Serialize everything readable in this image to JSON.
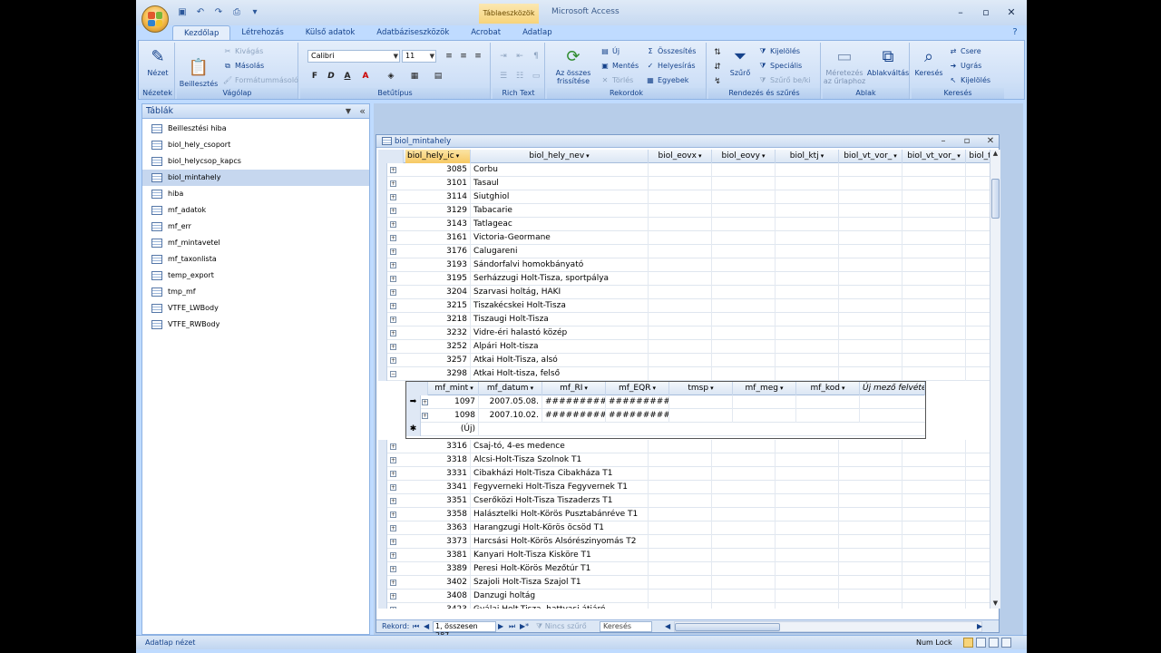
{
  "window": {
    "app_title": "Microsoft Access",
    "context_label": "Táblaeszközök",
    "colors": {
      "ribbon": "#dbe8f8",
      "selection": "#f7c964",
      "frame": "#bfdbff"
    }
  },
  "tabs": [
    "Kezdőlap",
    "Létrehozás",
    "Külső adatok",
    "Adatbáziseszközök",
    "Acrobat",
    "Adatlap"
  ],
  "ribbon": {
    "nezetek": {
      "label": "Nézetek",
      "view_btn": "Nézet"
    },
    "vagolap": {
      "label": "Vágólap",
      "paste": "Beillesztés",
      "cut": "Kivágás",
      "copy": "Másolás",
      "painter": "Formátummásoló"
    },
    "betutipus": {
      "label": "Betűtípus",
      "font": "Calibri",
      "size": "11"
    },
    "richtext": {
      "label": "Rich Text"
    },
    "rekordok": {
      "label": "Rekordok",
      "refresh": "Az összes frissítése",
      "new": "Új",
      "save": "Mentés",
      "delete": "Törlés",
      "totals": "Összesítés",
      "spelling": "Helyesírás",
      "more": "Egyebek"
    },
    "rendezes": {
      "label": "Rendezés és szűrés",
      "filter": "Szűrő",
      "selection": "Kijelölés",
      "advanced": "Speciális",
      "toggle": "Szűrő be/ki"
    },
    "ablak": {
      "label": "Ablak",
      "fit": "Méretezés az űrlaphoz",
      "switch": "Ablakváltás"
    },
    "kereses": {
      "label": "Keresés",
      "find": "Keresés",
      "replace": "Csere",
      "goto": "Ugrás",
      "select": "Kijelölés"
    }
  },
  "nav": {
    "title": "Táblák",
    "items": [
      "Beillesztési hiba",
      "biol_hely_csoport",
      "biol_helycsop_kapcs",
      "biol_mintahely",
      "hiba",
      "mf_adatok",
      "mf_err",
      "mf_mintavetel",
      "mf_taxonlista",
      "temp_export",
      "tmp_mf",
      "VTFE_LWBody",
      "VTFE_RWBody"
    ],
    "selected": "biol_mintahely"
  },
  "table": {
    "title": "biol_mintahely",
    "columns": [
      "biol_hely_ic",
      "biol_hely_nev",
      "biol_eovx",
      "biol_eovy",
      "biol_ktj",
      "biol_vt_vor_",
      "biol_vt_vor_",
      "biol_t"
    ],
    "rows_top": [
      [
        "3085",
        "Corbu"
      ],
      [
        "3101",
        "Tasaul"
      ],
      [
        "3114",
        "Siutghiol"
      ],
      [
        "3129",
        "Tabacarie"
      ],
      [
        "3143",
        "Tatlageac"
      ],
      [
        "3161",
        "Victoria-Geormane"
      ],
      [
        "3176",
        "Calugareni"
      ],
      [
        "3193",
        "Sándorfalvi homokbányató"
      ],
      [
        "3195",
        "Serházzugi Holt-Tisza, sportpálya"
      ],
      [
        "3204",
        "Szarvasi holtág, HAKI"
      ],
      [
        "3215",
        "Tiszakécskei Holt-Tisza"
      ],
      [
        "3218",
        "Tiszaugi Holt-Tisza"
      ],
      [
        "3232",
        "Vidre-éri halastó közép"
      ],
      [
        "3252",
        "Alpári Holt-tisza"
      ],
      [
        "3257",
        "Atkai Holt-Tisza, alsó"
      ],
      [
        "3298",
        "Atkai Holt-tisza, felső"
      ]
    ],
    "rows_bottom": [
      [
        "3316",
        "Csaj-tó, 4-es medence"
      ],
      [
        "3318",
        "Alcsi-Holt-Tisza Szolnok T1"
      ],
      [
        "3331",
        "Cibakházi Holt-Tisza Cibakháza T1"
      ],
      [
        "3341",
        "Fegyverneki Holt-Tisza Fegyvernek T1"
      ],
      [
        "3351",
        "Cserőközi Holt-Tisza Tiszaderzs T1"
      ],
      [
        "3358",
        "Halásztelki Holt-Körös Pusztabánréve T1"
      ],
      [
        "3363",
        "Harangzugi Holt-Körös öcsöd T1"
      ],
      [
        "3373",
        "Harcsási Holt-Körös Alsórészinyomás T2"
      ],
      [
        "3381",
        "Kanyari Holt-Tisza Kisköre T1"
      ],
      [
        "3389",
        "Peresi Holt-Körös Mezőtúr T1"
      ],
      [
        "3402",
        "Szajoli Holt-Tisza Szajol T1"
      ],
      [
        "3408",
        "Danzugi holtág"
      ],
      [
        "3423",
        "Gyálai Holt-Tisza, hattyasi átjáró"
      ]
    ]
  },
  "subtable": {
    "columns": [
      "mf_mint",
      "mf_datum",
      "mf_RI",
      "mf_EQR",
      "tmsp",
      "mf_meg",
      "mf_kod",
      "Új mező felvétele"
    ],
    "rows": [
      [
        "1097",
        "2007.05.08.",
        "##########",
        "##########"
      ],
      [
        "1098",
        "2007.10.02.",
        "##########",
        "##########"
      ]
    ],
    "new_row": "(Új)"
  },
  "recnav": {
    "label": "Rekord:",
    "position": "1, összesen 287",
    "filter": "Nincs szűrő",
    "search": "Keresés"
  },
  "status": {
    "left": "Adatlap nézet",
    "numlock": "Num Lock"
  }
}
